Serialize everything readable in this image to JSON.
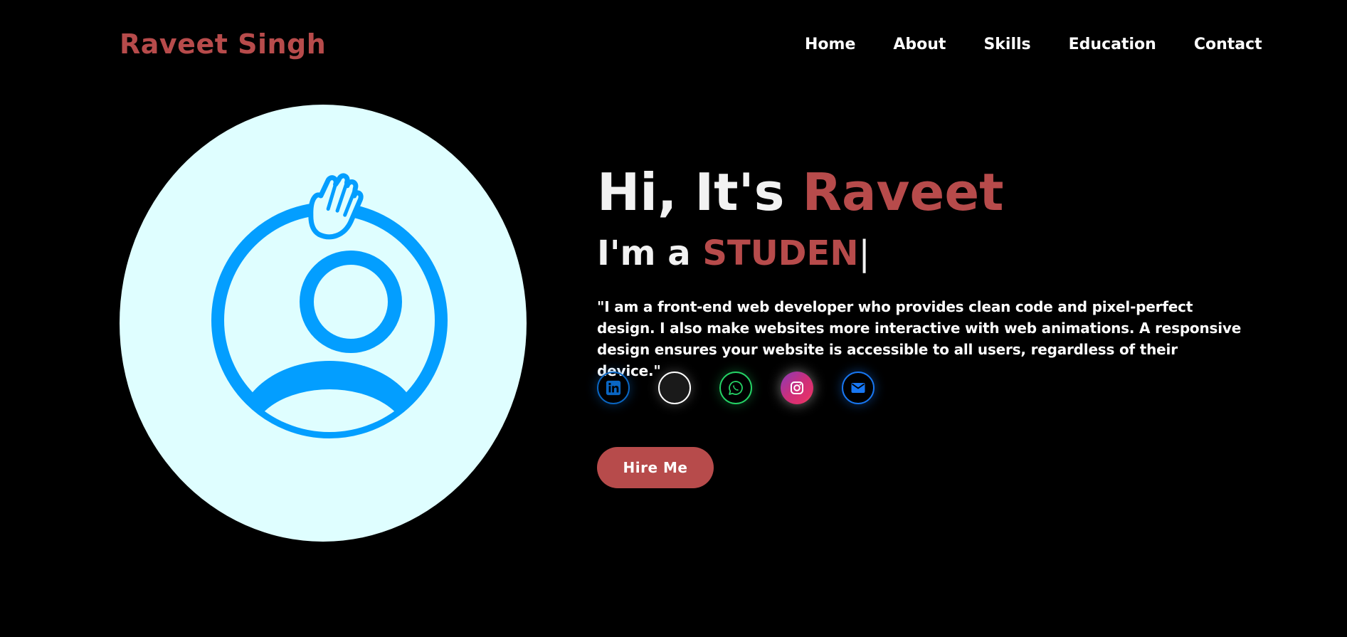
{
  "header": {
    "logo": "Raveet Singh",
    "nav": [
      "Home",
      "About",
      "Skills",
      "Education",
      "Contact"
    ]
  },
  "hero": {
    "greeting_prefix": "Hi, It's ",
    "greeting_name": "Raveet",
    "role_prefix": "I'm a ",
    "role_typed": "STUDEN",
    "caret": "|",
    "description": "\"I am a front-end web developer who provides clean code and pixel-perfect design. I also make websites more interactive with web animations. A responsive design ensures your website is accessible to all users, regardless of their device.\"",
    "cta_label": "Hire Me"
  },
  "socials": [
    {
      "name": "linkedin-icon",
      "color": "#0a66c2"
    },
    {
      "name": "github-icon",
      "color": "#ffffff"
    },
    {
      "name": "whatsapp-icon",
      "color": "#25d366"
    },
    {
      "name": "instagram-icon",
      "color": "#e1306c"
    },
    {
      "name": "mail-icon",
      "color": "#1877f2"
    }
  ],
  "colors": {
    "accent": "#b74b4b",
    "background": "#000000",
    "avatar_bg": "#dffeff",
    "avatar_icon": "#039eff"
  }
}
